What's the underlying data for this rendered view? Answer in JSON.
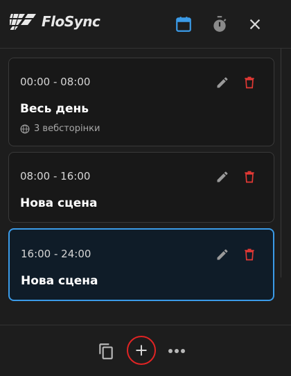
{
  "app": {
    "name": "FloSync"
  },
  "header": {
    "icons": [
      "logo-icon",
      "calendar-icon",
      "timer-icon",
      "close-icon"
    ],
    "accent_color": "#3b9be8"
  },
  "scenes": [
    {
      "time": "00:00 - 08:00",
      "title": "Весь день",
      "meta": "3 вебсторінки",
      "meta_icon": "globe-icon",
      "active": false
    },
    {
      "time": "08:00 - 16:00",
      "title": "Нова сцена",
      "active": false
    },
    {
      "time": "16:00 - 24:00",
      "title": "Нова сцена",
      "active": true
    }
  ],
  "card_actions": {
    "edit_icon": "pencil-icon",
    "delete_icon": "trash-icon",
    "delete_color": "#e53935"
  },
  "footer": {
    "icons": [
      "copy-icon",
      "plus-icon",
      "more-icon"
    ],
    "highlight_color": "#e02424"
  }
}
